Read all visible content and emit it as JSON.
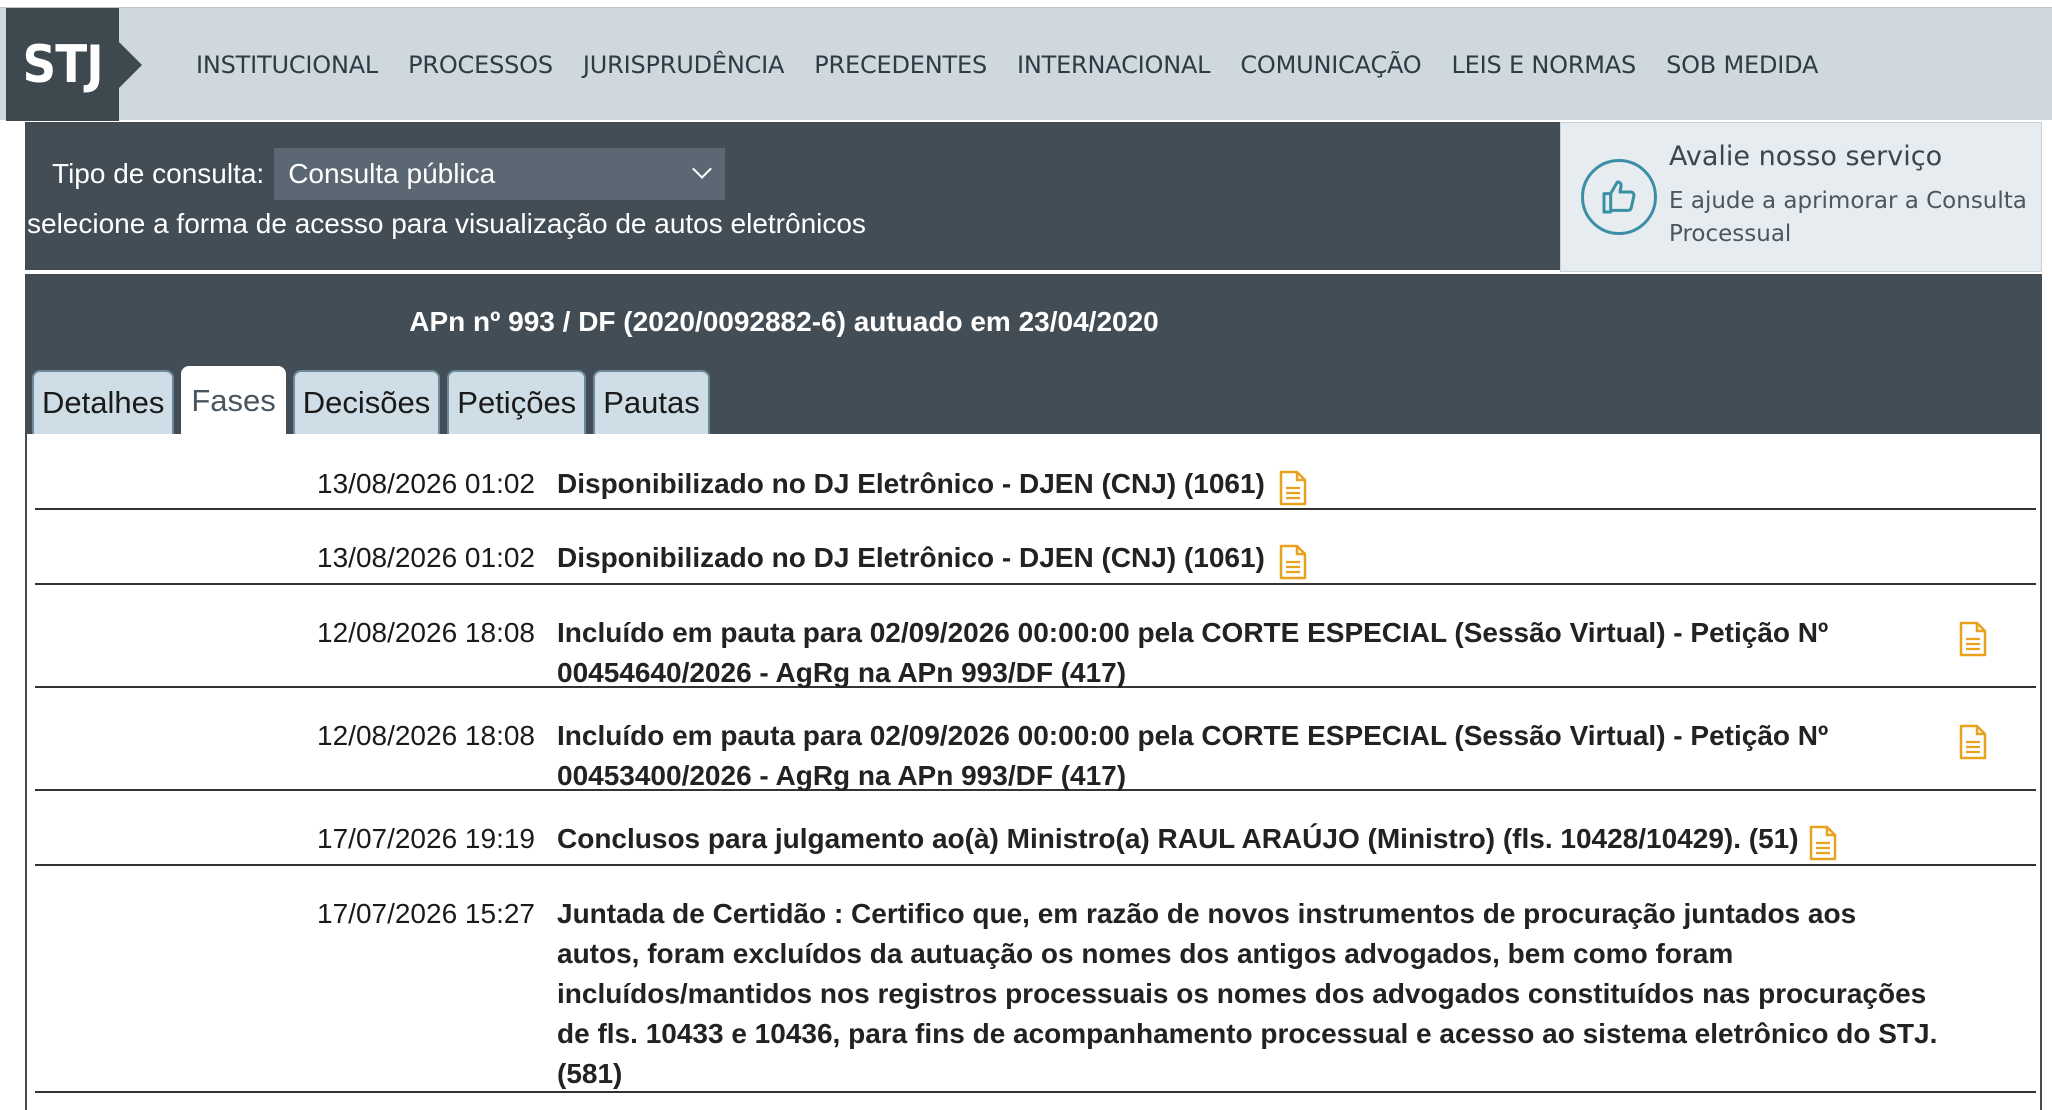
{
  "header": {
    "logo_text": "STJ",
    "nav": [
      "INSTITUCIONAL",
      "PROCESSOS",
      "JURISPRUDÊNCIA",
      "PRECEDENTES",
      "INTERNACIONAL",
      "COMUNICAÇÃO",
      "LEIS E NORMAS",
      "SOB MEDIDA"
    ]
  },
  "query": {
    "label": "Tipo de consulta:",
    "selected": "Consulta pública",
    "subtitle": "selecione a forma de acesso para visualização de autos eletrônicos"
  },
  "evaluate": {
    "title": "Avalie nosso serviço",
    "description": "E ajude a aprimorar a Consulta Processual",
    "icon": "thumbs-up-icon"
  },
  "process": {
    "title": "APn nº 993 / DF (2020/0092882-6) autuado em 23/04/2020",
    "tabs": [
      "Detalhes",
      "Fases",
      "Decisões",
      "Petições",
      "Pautas"
    ],
    "active_tab": "Fases"
  },
  "phases": [
    {
      "date": "13/08/2026 01:02",
      "lines": [
        "Disponibilizado no DJ Eletrônico - DJEN (CNJ) (1061)"
      ]
    },
    {
      "date": "13/08/2026 01:02",
      "lines": [
        "Disponibilizado no DJ Eletrônico - DJEN (CNJ) (1061)"
      ]
    },
    {
      "date": "12/08/2026 18:08",
      "lines": [
        "Incluído em pauta para 02/09/2026 00:00:00 pela CORTE ESPECIAL (Sessão Virtual) - Petição Nº",
        "00454640/2026 - AgRg na APn 993/DF (417)"
      ]
    },
    {
      "date": "12/08/2026 18:08",
      "lines": [
        "Incluído em pauta para 02/09/2026 00:00:00 pela CORTE ESPECIAL (Sessão Virtual) - Petição Nº",
        "00453400/2026 - AgRg na APn 993/DF (417)"
      ]
    },
    {
      "date": "17/07/2026 19:19",
      "lines": [
        "Conclusos para julgamento ao(à) Ministro(a) RAUL ARAÚJO (Ministro) (fls. 10428/10429). (51)"
      ]
    },
    {
      "date": "17/07/2026 15:27",
      "lines": [
        "Juntada de Certidão : Certifico que, em razão de novos instrumentos de procuração juntados aos",
        "autos, foram excluídos da autuação os nomes dos antigos advogados, bem como foram",
        "incluídos/mantidos nos registros processuais os nomes dos advogados constituídos nas procurações",
        "de fls. 10433 e 10436, para fins de acompanhamento processual e acesso ao sistema eletrônico do STJ.",
        "(581)"
      ]
    }
  ],
  "colors": {
    "accent": "#e9a21f",
    "panel": "#434d55",
    "nav_bg": "#cfd8dd"
  }
}
